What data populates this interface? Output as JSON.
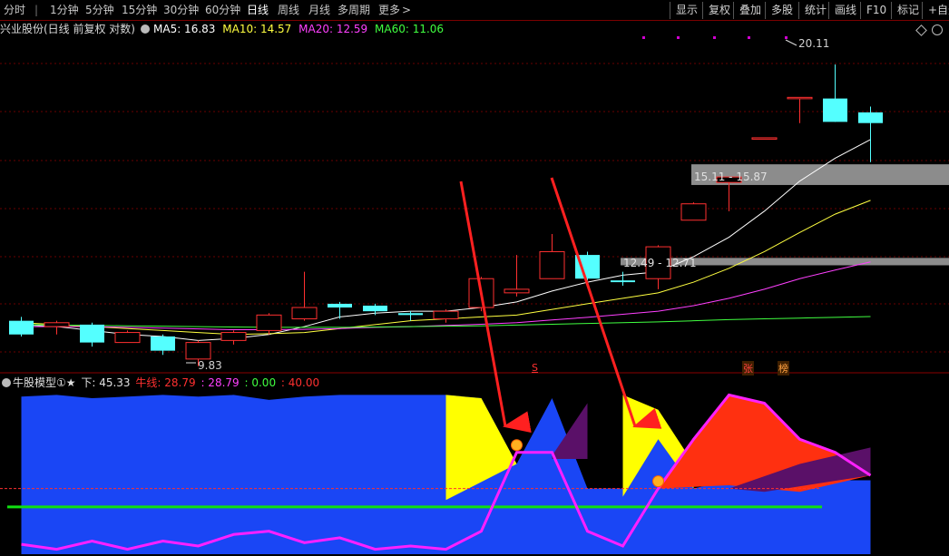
{
  "toolbar": {
    "tabs": [
      "分时",
      "1分钟",
      "5分钟",
      "15分钟",
      "30分钟",
      "60分钟",
      "日线",
      "周线",
      "月线",
      "多周期",
      "更多"
    ],
    "active_tab": "日线",
    "more_arrow": ">",
    "right_buttons": [
      "显示",
      "复权",
      "叠加",
      "多股",
      "统计",
      "画线",
      "F10",
      "标记",
      "+自选"
    ]
  },
  "header": {
    "title": "兴业股份(日线 前复权 对数)",
    "ma5": "MA5: 16.83",
    "ma10": "MA10: 14.57",
    "ma20": "MA20: 12.59",
    "ma60": "MA60: 11.06"
  },
  "chart_annotations": {
    "high_label": "20.11",
    "low_label": "9.83",
    "zone1_label": "15.11 - 15.87",
    "zone2_label": "12.49 - 12.71",
    "signal_s": "S",
    "tag_zhang": "张",
    "tag_bang": "榜"
  },
  "indicator": {
    "title": "牛股模型①★",
    "down_label": "下: 45.33",
    "bull_line_label": "牛线: 28.79",
    "val2": ": 28.79",
    "val3": ": 0.00",
    "val4": ": 40.00"
  },
  "colors": {
    "up_candle": "#ff3030",
    "down_candle": "#54ffff",
    "ma5": "#ffffff",
    "ma10": "#ffff40",
    "ma20": "#ff40ff",
    "ma60": "#40ff40",
    "indicator_blue": "#1a46f5",
    "indicator_yellow": "#ffff00",
    "indicator_red": "#ff3010",
    "indicator_purple": "#5a1068",
    "bull_line": "#ff20ff",
    "green_level": "#10e010"
  },
  "chart_data": {
    "type": "candlestick",
    "title": "兴业股份(日线 前复权 对数)",
    "candles": [
      {
        "o": 10.95,
        "h": 11.05,
        "l": 10.55,
        "c": 10.6
      },
      {
        "o": 10.8,
        "h": 10.95,
        "l": 10.6,
        "c": 10.9
      },
      {
        "o": 10.85,
        "h": 10.9,
        "l": 10.3,
        "c": 10.4
      },
      {
        "o": 10.4,
        "h": 10.7,
        "l": 10.4,
        "c": 10.65
      },
      {
        "o": 10.55,
        "h": 10.6,
        "l": 10.1,
        "c": 10.2
      },
      {
        "o": 10.0,
        "h": 10.45,
        "l": 9.83,
        "c": 10.4
      },
      {
        "o": 10.45,
        "h": 10.7,
        "l": 10.35,
        "c": 10.65
      },
      {
        "o": 10.7,
        "h": 11.15,
        "l": 10.6,
        "c": 11.1
      },
      {
        "o": 11.0,
        "h": 12.3,
        "l": 10.95,
        "c": 11.3
      },
      {
        "o": 11.4,
        "h": 11.45,
        "l": 11.0,
        "c": 11.3
      },
      {
        "o": 11.35,
        "h": 11.4,
        "l": 11.1,
        "c": 11.2
      },
      {
        "o": 11.15,
        "h": 11.2,
        "l": 10.95,
        "c": 11.1
      },
      {
        "o": 11.0,
        "h": 11.25,
        "l": 10.9,
        "c": 11.2
      },
      {
        "o": 11.3,
        "h": 12.15,
        "l": 11.2,
        "c": 12.1
      },
      {
        "o": 11.7,
        "h": 12.8,
        "l": 11.6,
        "c": 11.8
      },
      {
        "o": 12.1,
        "h": 13.45,
        "l": 12.1,
        "c": 12.9
      },
      {
        "o": 12.8,
        "h": 12.9,
        "l": 12.05,
        "c": 12.1
      },
      {
        "o": 12.05,
        "h": 12.3,
        "l": 11.9,
        "c": 12.0
      },
      {
        "o": 12.1,
        "h": 13.1,
        "l": 11.8,
        "c": 13.05
      },
      {
        "o": 13.9,
        "h": 14.5,
        "l": 13.9,
        "c": 14.45
      },
      {
        "o": 15.2,
        "h": 15.4,
        "l": 14.2,
        "c": 15.4
      },
      {
        "o": 16.9,
        "h": 16.9,
        "l": 16.9,
        "c": 16.9
      },
      {
        "o": 18.6,
        "h": 18.6,
        "l": 17.5,
        "c": 18.6
      },
      {
        "o": 18.55,
        "h": 20.11,
        "l": 17.55,
        "c": 17.55
      },
      {
        "o": 17.95,
        "h": 18.2,
        "l": 15.95,
        "c": 17.5
      }
    ],
    "ma_series": [
      {
        "name": "MA5",
        "values": [
          10.85,
          10.8,
          10.7,
          10.6,
          10.55,
          10.45,
          10.5,
          10.6,
          10.8,
          11.05,
          11.15,
          11.2,
          11.2,
          11.3,
          11.45,
          11.75,
          12.0,
          12.2,
          12.3,
          12.75,
          13.35,
          14.2,
          15.25,
          16.1,
          16.83
        ]
      },
      {
        "name": "MA10",
        "values": [
          10.9,
          10.85,
          10.8,
          10.75,
          10.7,
          10.65,
          10.6,
          10.62,
          10.65,
          10.75,
          10.85,
          10.95,
          11.0,
          11.05,
          11.1,
          11.25,
          11.4,
          11.55,
          11.7,
          12.0,
          12.4,
          12.9,
          13.5,
          14.1,
          14.57
        ]
      },
      {
        "name": "MA20",
        "values": [
          10.8,
          10.8,
          10.8,
          10.78,
          10.76,
          10.74,
          10.72,
          10.72,
          10.73,
          10.75,
          10.78,
          10.8,
          10.83,
          10.86,
          10.9,
          10.97,
          11.04,
          11.12,
          11.2,
          11.35,
          11.55,
          11.8,
          12.1,
          12.35,
          12.59
        ]
      },
      {
        "name": "MA60",
        "values": [
          10.85,
          10.84,
          10.83,
          10.82,
          10.81,
          10.8,
          10.79,
          10.78,
          10.78,
          10.78,
          10.79,
          10.8,
          10.81,
          10.82,
          10.84,
          10.86,
          10.88,
          10.9,
          10.92,
          10.95,
          10.98,
          11.0,
          11.02,
          11.04,
          11.06
        ]
      }
    ],
    "zones": [
      {
        "low": 15.11,
        "high": 15.87
      },
      {
        "low": 12.49,
        "high": 12.71
      }
    ],
    "indicator": {
      "name": "牛股模型①★",
      "blue_area": [
        96,
        97,
        95,
        96,
        97,
        96,
        97,
        94,
        96,
        97,
        97,
        97,
        97,
        95,
        55,
        95,
        40,
        40,
        85,
        40,
        45,
        45,
        45,
        45,
        45
      ],
      "yellow_area": [
        null,
        null,
        null,
        null,
        null,
        null,
        null,
        null,
        null,
        null,
        null,
        null,
        97,
        95,
        55,
        null,
        null,
        97,
        88,
        55,
        null,
        null,
        null,
        null,
        null
      ],
      "bull_line": [
        6,
        3,
        8,
        3,
        8,
        5,
        12,
        14,
        7,
        10,
        3,
        5,
        3,
        14,
        62,
        62,
        14,
        5,
        40,
        70,
        97,
        92,
        70,
        62,
        48
      ],
      "green_level": 28.79,
      "dashed_level": 40.0
    }
  }
}
